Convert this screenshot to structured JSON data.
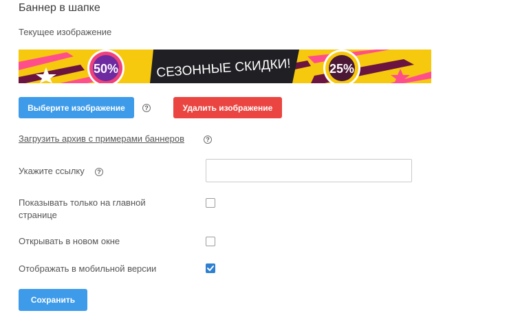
{
  "section": {
    "title": "Баннер в шапке"
  },
  "image": {
    "current_label": "Текущее изображение",
    "banner": {
      "left_badge": "50%",
      "center_text": "СЕЗОННЫЕ СКИДКИ!",
      "right_badge": "25%"
    }
  },
  "buttons": {
    "choose_image": "Выберите изображение",
    "delete_image": "Удалить изображение",
    "save": "Сохранить"
  },
  "help_glyph": "?",
  "download_link": "Загрузить архив с примерами баннеров",
  "url_field": {
    "label": "Укажите ссылку",
    "value": ""
  },
  "options": {
    "main_page_only": {
      "label_line1": "Показывать только на главной",
      "label_line2": "странице",
      "checked": false
    },
    "new_window": {
      "label": "Открывать в новом окне",
      "checked": false
    },
    "mobile_version": {
      "label": "Отображать в мобильной версии",
      "checked": true
    }
  },
  "colors": {
    "primary": "#3d9be9",
    "danger": "#ea4540",
    "checked": "#2f80d1",
    "banner_yellow": "#f6c90e"
  }
}
